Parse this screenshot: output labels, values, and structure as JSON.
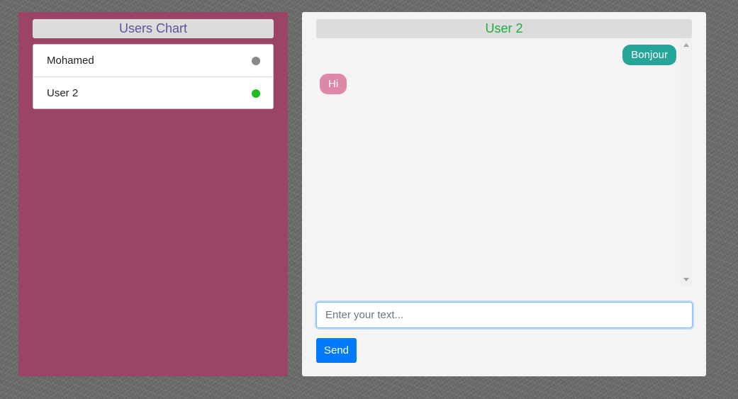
{
  "users_panel": {
    "title": "Users Chart",
    "title_color": "#5a5499",
    "background_color": "#9c4467",
    "users": [
      {
        "name": "Mohamed",
        "status_color": "#888888",
        "status": "offline"
      },
      {
        "name": "User 2",
        "status_color": "#22bb22",
        "status": "online"
      }
    ]
  },
  "chat": {
    "title": "User 2",
    "title_color": "#28a745",
    "messages": [
      {
        "text": "Bonjour",
        "direction": "outgoing",
        "color": "#26a69a"
      },
      {
        "text": "Hi",
        "direction": "incoming",
        "color": "#dd88a8"
      }
    ],
    "input": {
      "value": "",
      "placeholder": "Enter your text..."
    },
    "send_label": "Send",
    "send_color": "#007bff"
  }
}
